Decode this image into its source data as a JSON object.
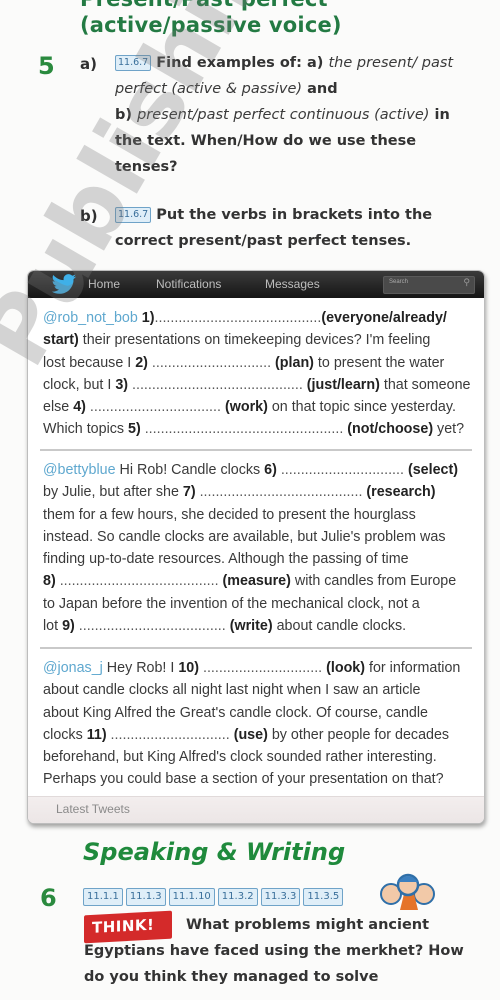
{
  "section_heading": {
    "line1": "Present/Past perfect",
    "line2": "(active/passive voice)"
  },
  "exercise5": {
    "number": "5",
    "part_a": {
      "label": "a)",
      "code": "11.6.7",
      "text_intro": "Find examples of: a)",
      "text_italic1": "the present/ past perfect (active & passive)",
      "text_and": "and",
      "text_b": "b)",
      "text_italic2": "present/past perfect continuous (active)",
      "text_rest": "in the text. When/How do we use these tenses?"
    },
    "part_b": {
      "label": "b)",
      "code": "11.6.7",
      "text": "Put the verbs in brackets into the correct present/past perfect tenses."
    }
  },
  "twitter": {
    "nav": [
      "Home",
      "Notifications",
      "Messages"
    ],
    "search_placeholder": "Search",
    "footer": "Latest Tweets",
    "tweets": [
      {
        "handle": "@rob_not_bob",
        "lines": [
          {
            "pre": "",
            "num": "1)",
            "dots": "..........................................",
            "verb": "(everyone/already/",
            "post": ""
          },
          {
            "pre": "",
            "num": "",
            "dots": "",
            "verb": "start)",
            "post": " their presentations on timekeeping devices? I'm feeling"
          },
          {
            "pre": "lost because I ",
            "num": "2)",
            "dots": " ..............................",
            "verb": " (plan)",
            "post": " to present the water"
          },
          {
            "pre": "clock, but I ",
            "num": "3)",
            "dots": " ...........................................",
            "verb": " (just/learn)",
            "post": " that someone"
          },
          {
            "pre": "else ",
            "num": "4)",
            "dots": " .................................",
            "verb": " (work)",
            "post": " on that topic since yesterday."
          },
          {
            "pre": "Which topics ",
            "num": "5)",
            "dots": " ..................................................",
            "verb": " (not/choose)",
            "post": " yet?"
          }
        ]
      },
      {
        "handle": "@bettyblue",
        "lines": [
          {
            "pre": " Hi Rob! Candle clocks ",
            "num": "6)",
            "dots": " ...............................",
            "verb": " (select)",
            "post": ""
          },
          {
            "pre": "by Julie, but after she ",
            "num": "7)",
            "dots": " .........................................",
            "verb": " (research)",
            "post": ""
          },
          {
            "pre": "them for a few hours, she decided to present the hourglass",
            "num": "",
            "dots": "",
            "verb": "",
            "post": ""
          },
          {
            "pre": "instead. So candle clocks are available, but Julie's problem was",
            "num": "",
            "dots": "",
            "verb": "",
            "post": ""
          },
          {
            "pre": "finding up-to-date resources. Although the passing of time",
            "num": "",
            "dots": "",
            "verb": "",
            "post": ""
          },
          {
            "pre": "",
            "num": "8)",
            "dots": " ........................................",
            "verb": " (measure)",
            "post": " with candles from Europe"
          },
          {
            "pre": "to Japan before the invention of the mechanical clock, not a",
            "num": "",
            "dots": "",
            "verb": "",
            "post": ""
          },
          {
            "pre": "lot ",
            "num": "9)",
            "dots": " .....................................",
            "verb": " (write)",
            "post": " about candle clocks."
          }
        ]
      },
      {
        "handle": "@jonas_j",
        "lines": [
          {
            "pre": " Hey Rob! I ",
            "num": "10)",
            "dots": " ..............................",
            "verb": " (look)",
            "post": " for information"
          },
          {
            "pre": "about candle clocks all night last night when I saw an article",
            "num": "",
            "dots": "",
            "verb": "",
            "post": ""
          },
          {
            "pre": "about King Alfred the Great's candle clock. Of course, candle",
            "num": "",
            "dots": "",
            "verb": "",
            "post": ""
          },
          {
            "pre": "clocks ",
            "num": "11)",
            "dots": " ..............................",
            "verb": " (use)",
            "post": " by other people for decades"
          },
          {
            "pre": "beforehand, but King Alfred's clock sounded rather interesting.",
            "num": "",
            "dots": "",
            "verb": "",
            "post": ""
          },
          {
            "pre": "Perhaps you could base a section of your presentation on that?",
            "num": "",
            "dots": "",
            "verb": "",
            "post": ""
          }
        ]
      }
    ]
  },
  "speaking_writing": {
    "title": "Speaking & Writing",
    "number": "6",
    "codes": [
      "11.1.1",
      "11.1.3",
      "11.1.10",
      "11.3.2",
      "11.3.3",
      "11.3.5"
    ],
    "think_badge": "THINK!",
    "question": "What problems might ancient Egyptians have faced using the merkhet? How do you think they managed to solve"
  },
  "watermark": "Publishing",
  "colors": {
    "heading_green": "#237a43",
    "twitter_blue": "#5fa8cf",
    "think_red": "#d42a2a",
    "code_blue": "#dfeef8"
  }
}
